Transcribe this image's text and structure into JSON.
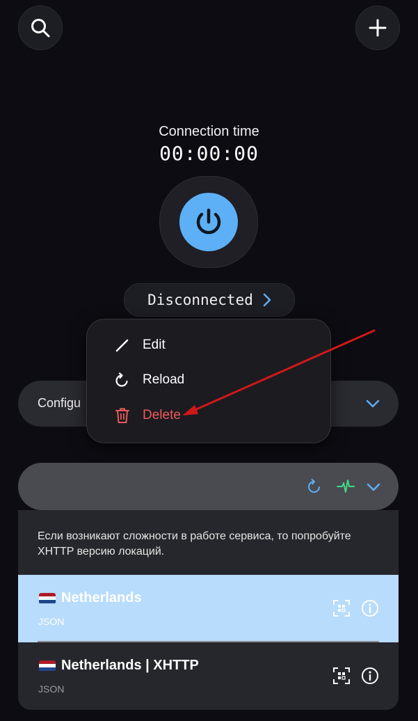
{
  "header": {
    "search_icon": "search-icon",
    "add_icon": "plus-icon"
  },
  "connection": {
    "label": "Connection time",
    "time": "00:00:00"
  },
  "status": {
    "text": "Disconnected"
  },
  "configuration": {
    "label": "Configu"
  },
  "context_menu": {
    "items": [
      {
        "label": "Edit",
        "icon": "pencil-icon"
      },
      {
        "label": "Reload",
        "icon": "reload-icon"
      },
      {
        "label": "Delete",
        "icon": "trash-icon",
        "color": "#ef5a5a"
      }
    ]
  },
  "notice": {
    "text": "Если возникают сложности в работе сервиса, то попробуйте XHTTP версию локаций."
  },
  "locations": [
    {
      "name": "Netherlands",
      "type": "JSON",
      "selected": true
    },
    {
      "name": "Netherlands | XHTTP",
      "type": "JSON",
      "selected": false
    }
  ],
  "colors": {
    "accent": "#5db0f5",
    "selected_row": "#b8dcfb",
    "delete": "#ef5a5a",
    "ping": "#3ddc84",
    "background": "#0c0c12"
  }
}
